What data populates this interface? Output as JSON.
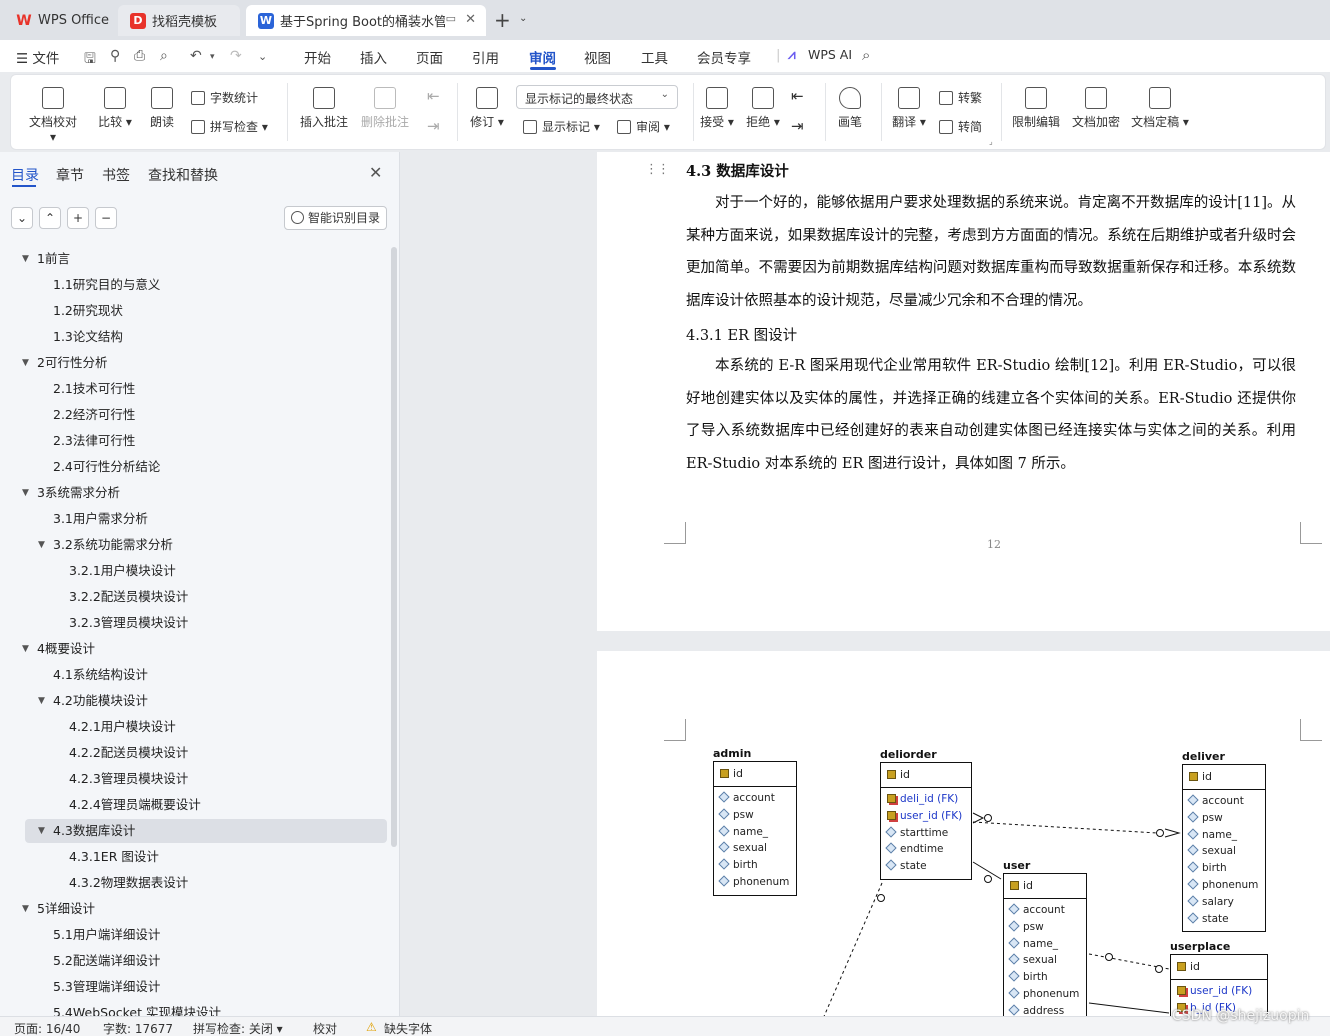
{
  "tabs": [
    {
      "label": "WPS Office",
      "icon": "wps-logo-icon"
    },
    {
      "label": "找稻壳模板",
      "icon": "docer-icon"
    },
    {
      "label": "基于Spring Boot的桶装水管理",
      "icon": "word-doc-icon",
      "active": true
    }
  ],
  "menu": {
    "file": "文件",
    "items": [
      "开始",
      "插入",
      "页面",
      "引用",
      "审阅",
      "视图",
      "工具",
      "会员专享"
    ],
    "active": "审阅",
    "wps_ai": "WPS AI"
  },
  "ribbon": {
    "doc_check": "文档校对",
    "compare": "比较",
    "read_aloud": "朗读",
    "word_count": "字数统计",
    "spell_check": "拼写检查",
    "insert_comment": "插入批注",
    "delete_comment": "删除批注",
    "revise": "修订",
    "mark_state": "显示标记的最终状态",
    "show_marks": "显示标记",
    "review": "审阅",
    "accept": "接受",
    "reject": "拒绝",
    "pen": "画笔",
    "translate": "翻译",
    "to_traditional": "转繁",
    "to_simplified": "转简",
    "restrict_edit": "限制编辑",
    "doc_encrypt": "文档加密",
    "doc_finalize": "文档定稿"
  },
  "nav": {
    "tabs": [
      "目录",
      "章节",
      "书签",
      "查找和替换"
    ],
    "active_tab": "目录",
    "smart_toc": "智能识别目录",
    "items": [
      {
        "label": "1前言",
        "level": 1,
        "expanded": true
      },
      {
        "label": "1.1研究目的与意义",
        "level": 2
      },
      {
        "label": "1.2研究现状",
        "level": 2
      },
      {
        "label": "1.3论文结构",
        "level": 2
      },
      {
        "label": "2可行性分析",
        "level": 1,
        "expanded": true
      },
      {
        "label": "2.1技术可行性",
        "level": 2
      },
      {
        "label": "2.2经济可行性",
        "level": 2
      },
      {
        "label": "2.3法律可行性",
        "level": 2
      },
      {
        "label": "2.4可行性分析结论",
        "level": 2
      },
      {
        "label": "3系统需求分析",
        "level": 1,
        "expanded": true
      },
      {
        "label": "3.1用户需求分析",
        "level": 2
      },
      {
        "label": "3.2系统功能需求分析",
        "level": 2,
        "expanded": true
      },
      {
        "label": "3.2.1用户模块设计",
        "level": 3
      },
      {
        "label": "3.2.2配送员模块设计",
        "level": 3
      },
      {
        "label": "3.2.3管理员模块设计",
        "level": 3
      },
      {
        "label": "4概要设计",
        "level": 1,
        "expanded": true
      },
      {
        "label": "4.1系统结构设计",
        "level": 2
      },
      {
        "label": "4.2功能模块设计",
        "level": 2,
        "expanded": true
      },
      {
        "label": "4.2.1用户模块设计",
        "level": 3
      },
      {
        "label": "4.2.2配送员模块设计",
        "level": 3
      },
      {
        "label": "4.2.3管理员模块设计",
        "level": 3
      },
      {
        "label": "4.2.4管理员端概要设计",
        "level": 3
      },
      {
        "label": "4.3数据库设计",
        "level": 2,
        "expanded": true,
        "selected": true
      },
      {
        "label": "4.3.1ER 图设计",
        "level": 3
      },
      {
        "label": "4.3.2物理数据表设计",
        "level": 3
      },
      {
        "label": "5详细设计",
        "level": 1,
        "expanded": true
      },
      {
        "label": "5.1用户端详细设计",
        "level": 2
      },
      {
        "label": "5.2配送端详细设计",
        "level": 2
      },
      {
        "label": "5.3管理端详细设计",
        "level": 2
      },
      {
        "label": "5.4WebSocket 实现模块设计",
        "level": 2
      }
    ]
  },
  "document": {
    "heading": "4.3  数据库设计",
    "para1": "对于一个好的，能够依据用户要求处理数据的系统来说。肯定离不开数据库的设计[11]。从某种方面来说，如果数据库设计的完整，考虑到方方面面的情况。系统在后期维护或者升级时会更加简单。不需要因为前期数据库结构问题对数据库重构而导致数据重新保存和迁移。本系统数据库设计依照基本的设计规范，尽量减少冗余和不合理的情况。",
    "subheading": "4.3.1  ER 图设计",
    "para2": "本系统的 E-R 图采用现代企业常用软件 ER-Studio 绘制[12]。利用 ER-Studio，可以很好地创建实体以及实体的属性，并选择正确的线建立各个实体间的关系。ER-Studio 还提供你了导入系统数据库中已经创建好的表来自动创建实体图已经连接实体与实体之间的关系。利用 ER-Studio 对本系统的 ER 图进行设计，具体如图 7 所示。",
    "page_number": "12"
  },
  "er": {
    "entities": [
      {
        "name": "admin",
        "pk": "id",
        "fields": [
          {
            "t": "account"
          },
          {
            "t": "psw"
          },
          {
            "t": "name_"
          },
          {
            "t": "sexual"
          },
          {
            "t": "birth"
          },
          {
            "t": "phonenum"
          }
        ]
      },
      {
        "name": "deliorder",
        "pk": "id",
        "fields": [
          {
            "t": "deli_id (FK)",
            "fk": true
          },
          {
            "t": "user_id (FK)",
            "fk": true
          },
          {
            "t": "starttime"
          },
          {
            "t": "endtime"
          },
          {
            "t": "state"
          }
        ]
      },
      {
        "name": "deliver",
        "pk": "id",
        "fields": [
          {
            "t": "account"
          },
          {
            "t": "psw"
          },
          {
            "t": "name_"
          },
          {
            "t": "sexual"
          },
          {
            "t": "birth"
          },
          {
            "t": "phonenum"
          },
          {
            "t": "salary"
          },
          {
            "t": "state"
          }
        ]
      },
      {
        "name": "user",
        "pk": "id",
        "fields": [
          {
            "t": "account"
          },
          {
            "t": "psw"
          },
          {
            "t": "name_"
          },
          {
            "t": "sexual"
          },
          {
            "t": "birth"
          },
          {
            "t": "phonenum"
          },
          {
            "t": "address"
          }
        ]
      },
      {
        "name": "userplace",
        "pk": "id",
        "fields": [
          {
            "t": "user_id (FK)",
            "fk": true
          },
          {
            "t": "b_id (FK)",
            "fk": true
          }
        ]
      }
    ]
  },
  "status": {
    "page": "页面: 16/40",
    "words": "字数: 17677",
    "spell": "拼写检查: 关闭",
    "proof": "校对",
    "missing_font": "缺失字体"
  },
  "watermark": "CSDN @shejizuopin",
  "colors": {
    "accent": "#2355c9",
    "wps_red": "#e8332a",
    "fk_blue": "#1b36c8"
  }
}
